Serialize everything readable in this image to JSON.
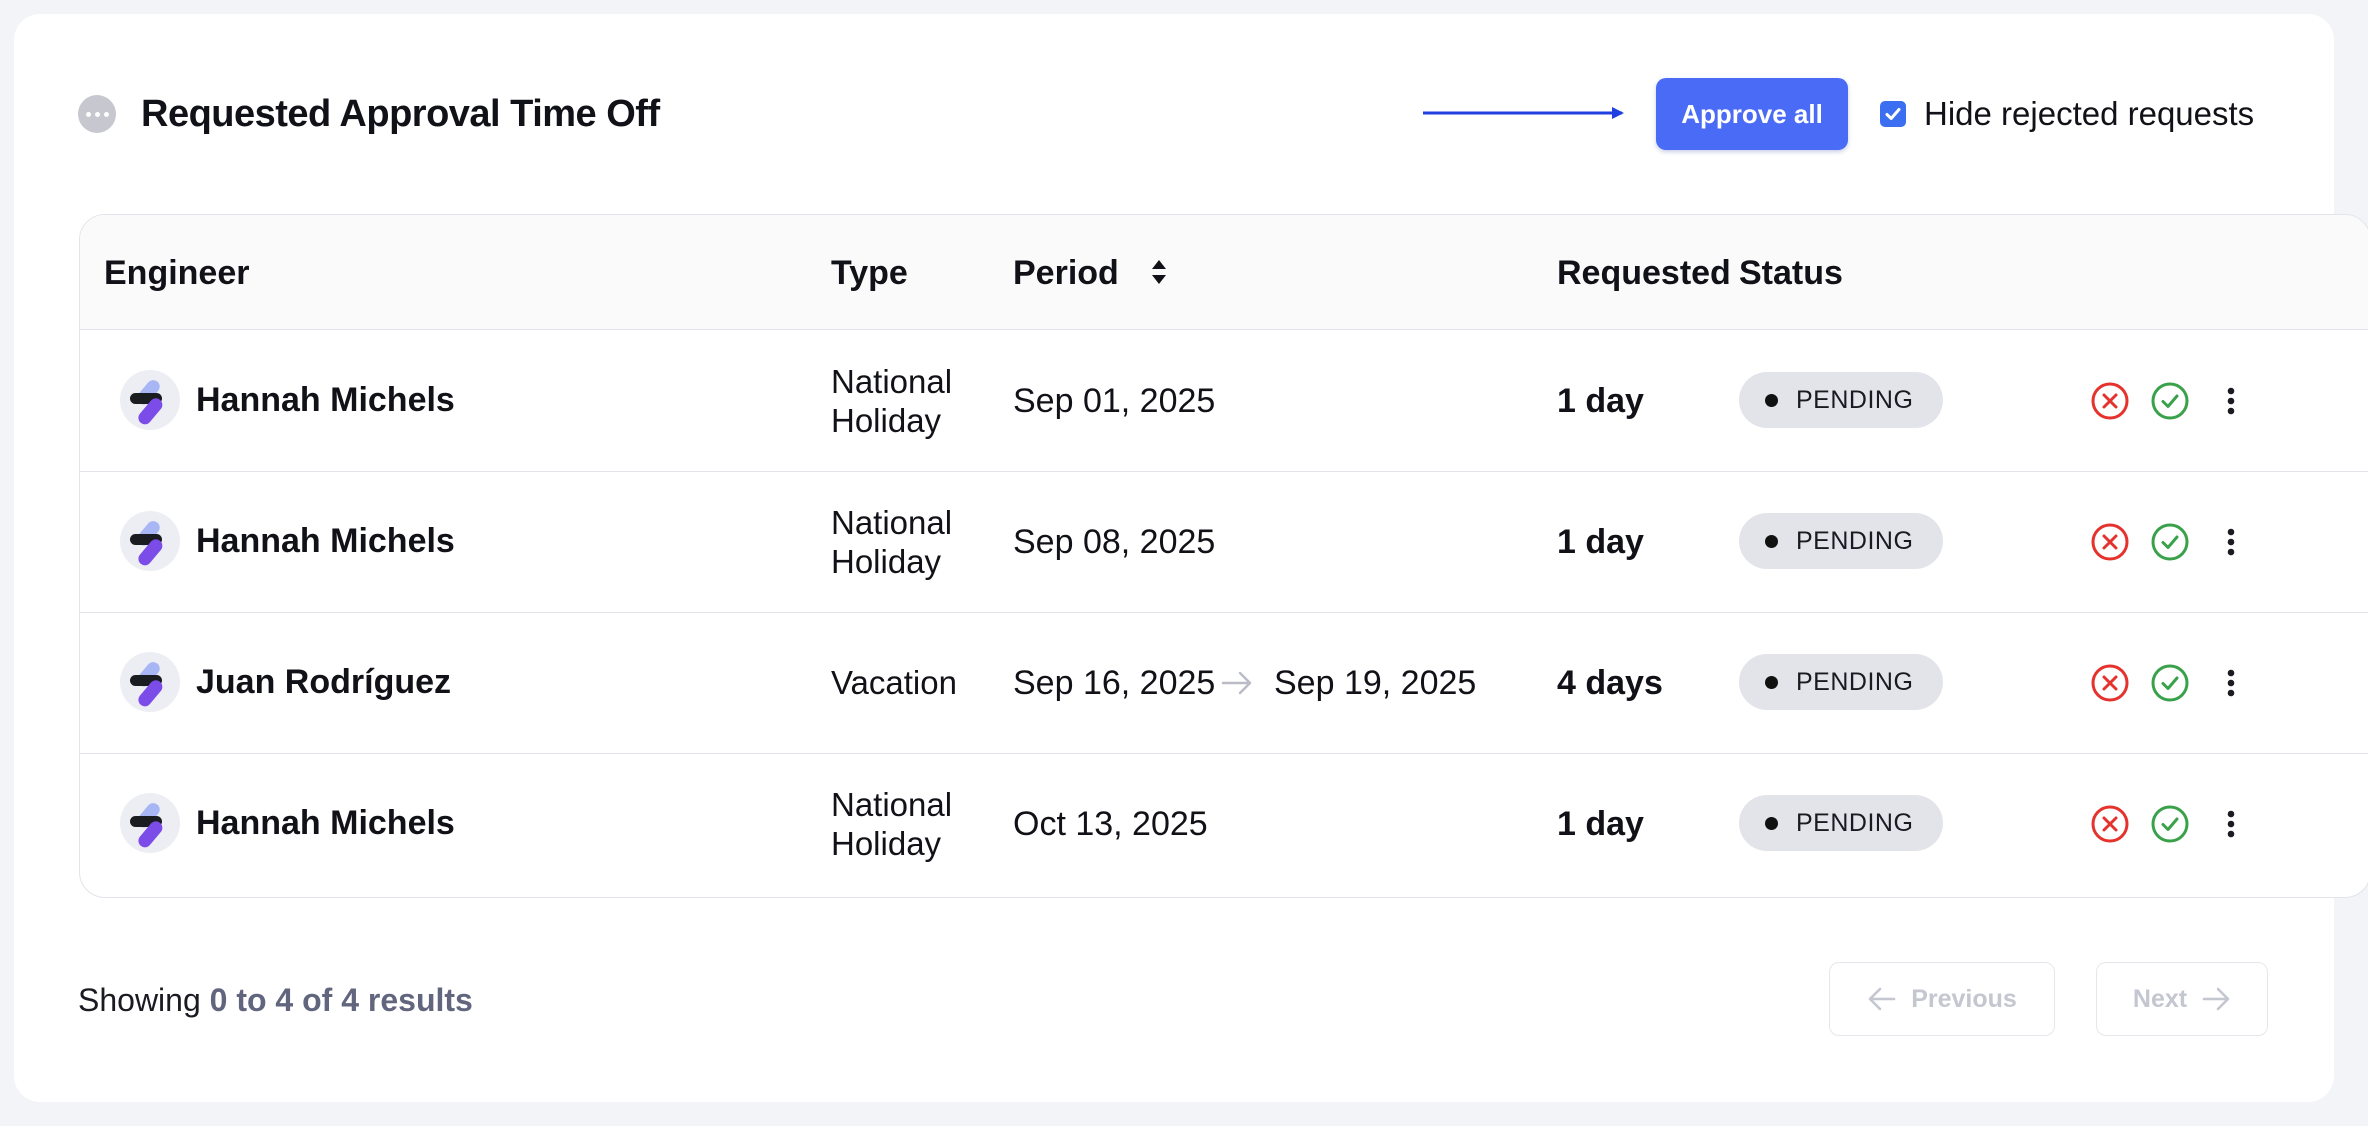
{
  "header": {
    "title": "Requested Approval Time Off",
    "approve_all_label": "Approve all",
    "hide_rejected_label": "Hide rejected requests",
    "hide_rejected_checked": true
  },
  "table": {
    "columns": {
      "engineer": "Engineer",
      "type": "Type",
      "period": "Period",
      "requested": "Requested",
      "status": "Status"
    },
    "rows": [
      {
        "engineer": "Hannah Michels",
        "type_line1": "National",
        "type_line2": "Holiday",
        "period_start": "Sep 01, 2025",
        "period_end": "",
        "requested": "1 day",
        "status": "PENDING"
      },
      {
        "engineer": "Hannah Michels",
        "type_line1": "National",
        "type_line2": "Holiday",
        "period_start": "Sep 08, 2025",
        "period_end": "",
        "requested": "1 day",
        "status": "PENDING"
      },
      {
        "engineer": "Juan Rodríguez",
        "type_line1": "Vacation",
        "type_line2": "",
        "period_start": "Sep 16, 2025",
        "period_end": "Sep 19, 2025",
        "requested": "4 days",
        "status": "PENDING"
      },
      {
        "engineer": "Hannah Michels",
        "type_line1": "National",
        "type_line2": "Holiday",
        "period_start": "Oct 13, 2025",
        "period_end": "",
        "requested": "1 day",
        "status": "PENDING"
      }
    ]
  },
  "footer": {
    "showing_prefix": "Showing",
    "showing_range": "0 to 4 of 4 results",
    "previous_label": "Previous",
    "next_label": "Next"
  },
  "icons": {
    "reject": "x-circle-icon",
    "approve": "check-circle-icon",
    "more": "more-vertical-icon",
    "sort": "sort-icon",
    "arrow": "arrow-right-icon"
  },
  "colors": {
    "accent": "#4a6bf5",
    "reject": "#e5322d",
    "approve": "#3aa14b",
    "badge_bg": "#e3e4ea",
    "annotation_arrow": "#1f3fe0"
  }
}
